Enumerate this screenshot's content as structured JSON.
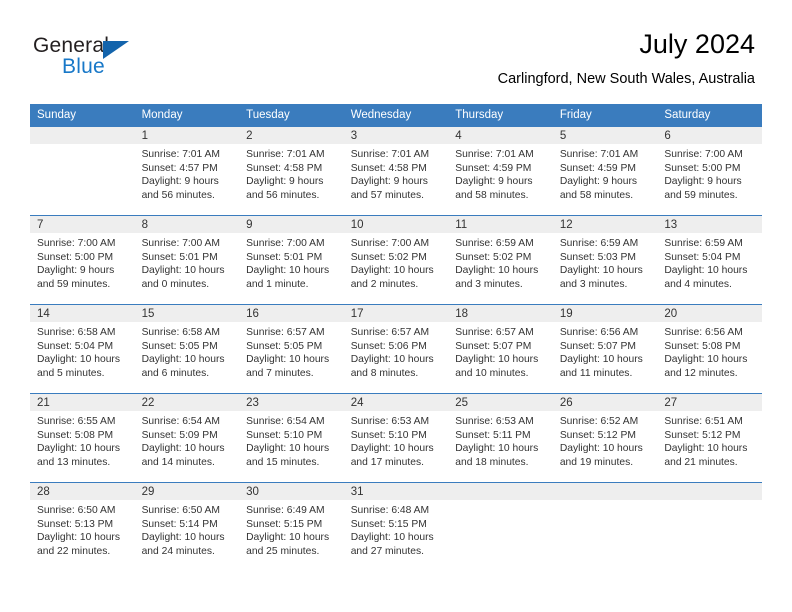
{
  "brand": {
    "name_part1": "General",
    "name_part2": "Blue",
    "triangle_color": "#1364ac",
    "blue_color": "#1878c8"
  },
  "header": {
    "title": "July 2024",
    "subtitle": "Carlingford, New South Wales, Australia"
  },
  "theme": {
    "header_blue": "#3a7cbe",
    "daynum_band": "#eeeeee",
    "text": "#333333"
  },
  "calendar": {
    "weekday_headers": [
      "Sunday",
      "Monday",
      "Tuesday",
      "Wednesday",
      "Thursday",
      "Friday",
      "Saturday"
    ],
    "labels": {
      "sunrise": "Sunrise:",
      "sunset": "Sunset:",
      "daylight": "Daylight:"
    },
    "weeks": [
      [
        {
          "day": "",
          "sunrise": "",
          "sunset": "",
          "daylight_line1": "",
          "daylight_line2": ""
        },
        {
          "day": "1",
          "sunrise": "Sunrise: 7:01 AM",
          "sunset": "Sunset: 4:57 PM",
          "daylight_line1": "Daylight: 9 hours",
          "daylight_line2": "and 56 minutes."
        },
        {
          "day": "2",
          "sunrise": "Sunrise: 7:01 AM",
          "sunset": "Sunset: 4:58 PM",
          "daylight_line1": "Daylight: 9 hours",
          "daylight_line2": "and 56 minutes."
        },
        {
          "day": "3",
          "sunrise": "Sunrise: 7:01 AM",
          "sunset": "Sunset: 4:58 PM",
          "daylight_line1": "Daylight: 9 hours",
          "daylight_line2": "and 57 minutes."
        },
        {
          "day": "4",
          "sunrise": "Sunrise: 7:01 AM",
          "sunset": "Sunset: 4:59 PM",
          "daylight_line1": "Daylight: 9 hours",
          "daylight_line2": "and 58 minutes."
        },
        {
          "day": "5",
          "sunrise": "Sunrise: 7:01 AM",
          "sunset": "Sunset: 4:59 PM",
          "daylight_line1": "Daylight: 9 hours",
          "daylight_line2": "and 58 minutes."
        },
        {
          "day": "6",
          "sunrise": "Sunrise: 7:00 AM",
          "sunset": "Sunset: 5:00 PM",
          "daylight_line1": "Daylight: 9 hours",
          "daylight_line2": "and 59 minutes."
        }
      ],
      [
        {
          "day": "7",
          "sunrise": "Sunrise: 7:00 AM",
          "sunset": "Sunset: 5:00 PM",
          "daylight_line1": "Daylight: 9 hours",
          "daylight_line2": "and 59 minutes."
        },
        {
          "day": "8",
          "sunrise": "Sunrise: 7:00 AM",
          "sunset": "Sunset: 5:01 PM",
          "daylight_line1": "Daylight: 10 hours",
          "daylight_line2": "and 0 minutes."
        },
        {
          "day": "9",
          "sunrise": "Sunrise: 7:00 AM",
          "sunset": "Sunset: 5:01 PM",
          "daylight_line1": "Daylight: 10 hours",
          "daylight_line2": "and 1 minute."
        },
        {
          "day": "10",
          "sunrise": "Sunrise: 7:00 AM",
          "sunset": "Sunset: 5:02 PM",
          "daylight_line1": "Daylight: 10 hours",
          "daylight_line2": "and 2 minutes."
        },
        {
          "day": "11",
          "sunrise": "Sunrise: 6:59 AM",
          "sunset": "Sunset: 5:02 PM",
          "daylight_line1": "Daylight: 10 hours",
          "daylight_line2": "and 3 minutes."
        },
        {
          "day": "12",
          "sunrise": "Sunrise: 6:59 AM",
          "sunset": "Sunset: 5:03 PM",
          "daylight_line1": "Daylight: 10 hours",
          "daylight_line2": "and 3 minutes."
        },
        {
          "day": "13",
          "sunrise": "Sunrise: 6:59 AM",
          "sunset": "Sunset: 5:04 PM",
          "daylight_line1": "Daylight: 10 hours",
          "daylight_line2": "and 4 minutes."
        }
      ],
      [
        {
          "day": "14",
          "sunrise": "Sunrise: 6:58 AM",
          "sunset": "Sunset: 5:04 PM",
          "daylight_line1": "Daylight: 10 hours",
          "daylight_line2": "and 5 minutes."
        },
        {
          "day": "15",
          "sunrise": "Sunrise: 6:58 AM",
          "sunset": "Sunset: 5:05 PM",
          "daylight_line1": "Daylight: 10 hours",
          "daylight_line2": "and 6 minutes."
        },
        {
          "day": "16",
          "sunrise": "Sunrise: 6:57 AM",
          "sunset": "Sunset: 5:05 PM",
          "daylight_line1": "Daylight: 10 hours",
          "daylight_line2": "and 7 minutes."
        },
        {
          "day": "17",
          "sunrise": "Sunrise: 6:57 AM",
          "sunset": "Sunset: 5:06 PM",
          "daylight_line1": "Daylight: 10 hours",
          "daylight_line2": "and 8 minutes."
        },
        {
          "day": "18",
          "sunrise": "Sunrise: 6:57 AM",
          "sunset": "Sunset: 5:07 PM",
          "daylight_line1": "Daylight: 10 hours",
          "daylight_line2": "and 10 minutes."
        },
        {
          "day": "19",
          "sunrise": "Sunrise: 6:56 AM",
          "sunset": "Sunset: 5:07 PM",
          "daylight_line1": "Daylight: 10 hours",
          "daylight_line2": "and 11 minutes."
        },
        {
          "day": "20",
          "sunrise": "Sunrise: 6:56 AM",
          "sunset": "Sunset: 5:08 PM",
          "daylight_line1": "Daylight: 10 hours",
          "daylight_line2": "and 12 minutes."
        }
      ],
      [
        {
          "day": "21",
          "sunrise": "Sunrise: 6:55 AM",
          "sunset": "Sunset: 5:08 PM",
          "daylight_line1": "Daylight: 10 hours",
          "daylight_line2": "and 13 minutes."
        },
        {
          "day": "22",
          "sunrise": "Sunrise: 6:54 AM",
          "sunset": "Sunset: 5:09 PM",
          "daylight_line1": "Daylight: 10 hours",
          "daylight_line2": "and 14 minutes."
        },
        {
          "day": "23",
          "sunrise": "Sunrise: 6:54 AM",
          "sunset": "Sunset: 5:10 PM",
          "daylight_line1": "Daylight: 10 hours",
          "daylight_line2": "and 15 minutes."
        },
        {
          "day": "24",
          "sunrise": "Sunrise: 6:53 AM",
          "sunset": "Sunset: 5:10 PM",
          "daylight_line1": "Daylight: 10 hours",
          "daylight_line2": "and 17 minutes."
        },
        {
          "day": "25",
          "sunrise": "Sunrise: 6:53 AM",
          "sunset": "Sunset: 5:11 PM",
          "daylight_line1": "Daylight: 10 hours",
          "daylight_line2": "and 18 minutes."
        },
        {
          "day": "26",
          "sunrise": "Sunrise: 6:52 AM",
          "sunset": "Sunset: 5:12 PM",
          "daylight_line1": "Daylight: 10 hours",
          "daylight_line2": "and 19 minutes."
        },
        {
          "day": "27",
          "sunrise": "Sunrise: 6:51 AM",
          "sunset": "Sunset: 5:12 PM",
          "daylight_line1": "Daylight: 10 hours",
          "daylight_line2": "and 21 minutes."
        }
      ],
      [
        {
          "day": "28",
          "sunrise": "Sunrise: 6:50 AM",
          "sunset": "Sunset: 5:13 PM",
          "daylight_line1": "Daylight: 10 hours",
          "daylight_line2": "and 22 minutes."
        },
        {
          "day": "29",
          "sunrise": "Sunrise: 6:50 AM",
          "sunset": "Sunset: 5:14 PM",
          "daylight_line1": "Daylight: 10 hours",
          "daylight_line2": "and 24 minutes."
        },
        {
          "day": "30",
          "sunrise": "Sunrise: 6:49 AM",
          "sunset": "Sunset: 5:15 PM",
          "daylight_line1": "Daylight: 10 hours",
          "daylight_line2": "and 25 minutes."
        },
        {
          "day": "31",
          "sunrise": "Sunrise: 6:48 AM",
          "sunset": "Sunset: 5:15 PM",
          "daylight_line1": "Daylight: 10 hours",
          "daylight_line2": "and 27 minutes."
        },
        {
          "day": "",
          "sunrise": "",
          "sunset": "",
          "daylight_line1": "",
          "daylight_line2": ""
        },
        {
          "day": "",
          "sunrise": "",
          "sunset": "",
          "daylight_line1": "",
          "daylight_line2": ""
        },
        {
          "day": "",
          "sunrise": "",
          "sunset": "",
          "daylight_line1": "",
          "daylight_line2": ""
        }
      ]
    ]
  }
}
